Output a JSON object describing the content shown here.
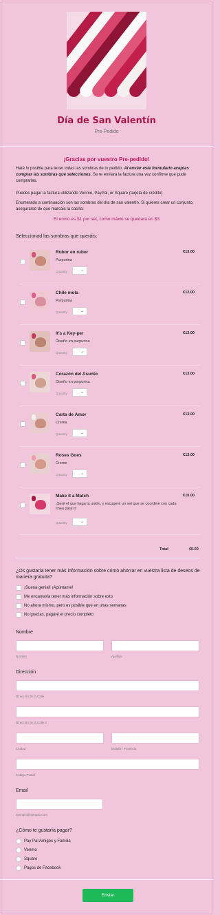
{
  "header": {
    "title": "Día de San Valentín",
    "subtitle": "Pre-Pedido"
  },
  "intro": {
    "heading": "¡Gracias por vuestro Pre-pedido!",
    "p1_start": "Haré lo posible para tener todas las sombras de tu pedido. ",
    "p1_bold": "Al enviar este formulario aceptas comprar las sombras que selecciones.",
    "p1_end": " Se te enviará la factura una vez confirme que pude comprarlas.",
    "p2": "Puedes pagar la factura utilizando Venmo, PayPal, or Square (tarjeta de crédito)",
    "p3": "Enumerado a continuación son las sombras del día de san valentín. Si quieres crear un conjunto, asegurarse de que marcáis la casilla:",
    "shipping": "El envío es $1 por set, como máxio se quedará en $3"
  },
  "products_label": "Seleccionad las sombras que queráis:",
  "quantity_label": "Quantity",
  "products": [
    {
      "name": "Rubor en rubor",
      "desc": "Purpurina",
      "price": "€13.00"
    },
    {
      "name": "Chile mola",
      "desc": "Purpurina",
      "price": "€12.00"
    },
    {
      "name": "It's a Key-per",
      "desc": "Diseño en purpurina",
      "price": "€13.00"
    },
    {
      "name": "Corazón del Asunto",
      "desc": "Diseño en purpurina",
      "price": "€13.00"
    },
    {
      "name": "Carta de Amor",
      "desc": "Crema",
      "price": "€13.00"
    },
    {
      "name": "Roses Goes",
      "desc": "Creme",
      "price": "€13.00"
    },
    {
      "name": "Make it a Match",
      "desc": "¡Seré el que haga la unión, y escogeré un set que se coordine con cada línea para ti!",
      "price": "€10.00"
    }
  ],
  "total": {
    "label": "Total",
    "value": "€0.00"
  },
  "wishlist": {
    "question": "¿Os gustaría tener más información sobre cómo ahorrar en vuestra lista de deseos de manera gratuita?",
    "options": [
      "¡Suena genial! ¡Apúntame!",
      "Me encantaría tener más información sobre esto",
      "No ahora mismo, pero es posible que en unas semanas",
      "No gracias, pagaré el precio completo"
    ]
  },
  "name": {
    "label": "Nombre",
    "first": "Nombre",
    "last": "Apellido"
  },
  "address": {
    "label": "Dirección",
    "street1": "Dirección de la Calle",
    "street2": "Dirección de la Calle 2",
    "city": "Ciudad",
    "state": "Estado / Provincia",
    "zip": "Código Postal"
  },
  "email": {
    "label": "Email",
    "hint": "ejemplo@ejemplo.com"
  },
  "payment": {
    "question": "¿Cómo te gustaría pagar?",
    "options": [
      "Pay Pal Amigos y Familia",
      "Venmo",
      "Square",
      "Pagos de Facebook"
    ]
  },
  "submit_label": "Enviar",
  "colors": {
    "accent": "#a6184a",
    "background": "#f1c6dc",
    "submit": "#1eba59"
  },
  "icons": {
    "select": "chevron-down-icon"
  }
}
